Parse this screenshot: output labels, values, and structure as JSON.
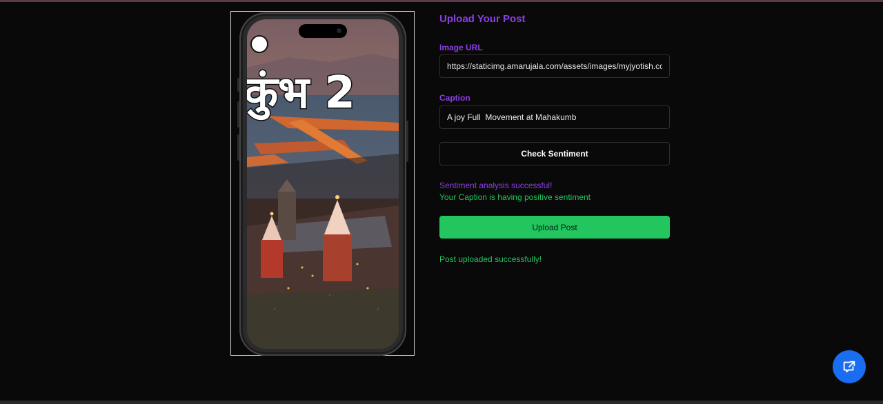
{
  "form": {
    "title": "Upload Your Post",
    "image_url_label": "Image URL",
    "image_url_value": "https://staticimg.amarujala.com/assets/images/myjyotish.com",
    "caption_label": "Caption",
    "caption_value": "A joy Full  Movement at Mahakumb",
    "check_button": "Check Sentiment",
    "status_success": "Sentiment analysis successful!",
    "status_sentiment": "Your Caption is having positive sentiment",
    "upload_button": "Upload Post",
    "upload_status": "Post uploaded successfully!"
  },
  "preview": {
    "overlay_text": "कुंभ 2",
    "icon": "smartphone-frame"
  },
  "fab": {
    "icon": "external-chat-icon"
  },
  "colors": {
    "background": "#0a0909",
    "accent_purple": "#8b3fe8",
    "success_green": "#22c55e",
    "fab_blue": "#1a6cf0"
  }
}
